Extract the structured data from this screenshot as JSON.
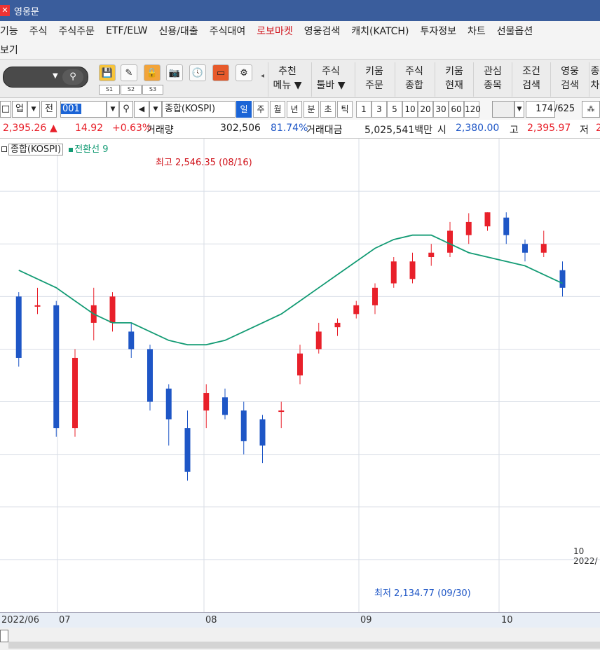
{
  "window": {
    "title": "영웅문",
    "icon": "kiwoom-icon"
  },
  "menu": {
    "row1": [
      "기능",
      "주식",
      "주식주문",
      "ETF/ELW",
      "신용/대출",
      "주식대여",
      "로보마켓",
      "영웅검색",
      "캐치(KATCH)",
      "투자정보",
      "차트",
      "선물옵션"
    ],
    "row2": [
      "보기"
    ]
  },
  "toolbar": {
    "s_tabs": [
      "S1",
      "S2",
      "S3"
    ],
    "buttons": [
      {
        "line1": "추천",
        "line2": "메뉴",
        "arrow": "▼"
      },
      {
        "line1": "주식",
        "line2": "툴바",
        "arrow": "▼"
      },
      {
        "line1": "키움",
        "line2": "주문",
        "arrow": ""
      },
      {
        "line1": "주식",
        "line2": "종합",
        "arrow": ""
      },
      {
        "line1": "키움",
        "line2": "현재",
        "arrow": ""
      },
      {
        "line1": "관심",
        "line2": "종목",
        "arrow": ""
      },
      {
        "line1": "조건",
        "line2": "검색",
        "arrow": ""
      },
      {
        "line1": "영웅",
        "line2": "검색",
        "arrow": ""
      },
      {
        "line1": "종",
        "line2": "차",
        "arrow": ""
      }
    ]
  },
  "stockbar": {
    "mode": "업",
    "prev": "전",
    "code": "001",
    "name": "종합(KOSPI)",
    "periods": [
      "일",
      "주",
      "월",
      "년",
      "분",
      "초",
      "틱"
    ],
    "active_period": "일",
    "intervals": [
      "1",
      "3",
      "5",
      "10",
      "20",
      "30",
      "60",
      "120"
    ],
    "count": "174",
    "total": "/625"
  },
  "quote": {
    "price": "2,395.26",
    "arrow": "▲",
    "change": "14.92",
    "pct": "+0.63%",
    "vol_label": "거래량",
    "volume": "302,506",
    "vol_ratio": "81.74%",
    "amount_label": "거래대금",
    "amount": "5,025,541백만",
    "open_label": "시",
    "open": "2,380.00",
    "high_label": "고",
    "high": "2,395.97",
    "low_label": "저",
    "low_partial": "2"
  },
  "legend": {
    "series1": "종합(KOSPI)",
    "series2": "전환선 9"
  },
  "colors": {
    "up": "#e8202a",
    "down": "#1e56c6",
    "line": "#139b74",
    "grid": "#d8dde6"
  },
  "annotations": {
    "high": "최고 2,546.35 (08/16)",
    "low": "최저 2,134.77 (09/30)",
    "label_10": "10",
    "label_2022": "2022/"
  },
  "dates": [
    "2022/06",
    "07",
    "08",
    "09",
    "10"
  ],
  "chart_data": {
    "type": "candlestick",
    "ylim": [
      2090,
      2630
    ],
    "candles": [
      {
        "o": 2450,
        "c": 2380,
        "h": 2455,
        "l": 2370
      },
      {
        "o": 2440,
        "c": 2440,
        "h": 2460,
        "l": 2430
      },
      {
        "o": 2440,
        "c": 2300,
        "h": 2445,
        "l": 2290
      },
      {
        "o": 2300,
        "c": 2380,
        "h": 2390,
        "l": 2290
      },
      {
        "o": 2420,
        "c": 2440,
        "h": 2460,
        "l": 2400
      },
      {
        "o": 2420,
        "c": 2450,
        "h": 2455,
        "l": 2410
      },
      {
        "o": 2410,
        "c": 2390,
        "h": 2420,
        "l": 2380
      },
      {
        "o": 2390,
        "c": 2330,
        "h": 2395,
        "l": 2320
      },
      {
        "o": 2345,
        "c": 2310,
        "h": 2350,
        "l": 2280
      },
      {
        "o": 2300,
        "c": 2250,
        "h": 2320,
        "l": 2240
      },
      {
        "o": 2320,
        "c": 2340,
        "h": 2350,
        "l": 2300
      },
      {
        "o": 2335,
        "c": 2315,
        "h": 2345,
        "l": 2310
      },
      {
        "o": 2320,
        "c": 2285,
        "h": 2330,
        "l": 2270
      },
      {
        "o": 2310,
        "c": 2280,
        "h": 2315,
        "l": 2260
      },
      {
        "o": 2320,
        "c": 2320,
        "h": 2330,
        "l": 2300
      },
      {
        "o": 2360,
        "c": 2385,
        "h": 2395,
        "l": 2350
      },
      {
        "o": 2390,
        "c": 2410,
        "h": 2420,
        "l": 2385
      },
      {
        "o": 2415,
        "c": 2420,
        "h": 2425,
        "l": 2405
      },
      {
        "o": 2430,
        "c": 2440,
        "h": 2445,
        "l": 2425
      },
      {
        "o": 2440,
        "c": 2460,
        "h": 2465,
        "l": 2430
      },
      {
        "o": 2465,
        "c": 2490,
        "h": 2495,
        "l": 2460
      },
      {
        "o": 2470,
        "c": 2490,
        "h": 2500,
        "l": 2465
      },
      {
        "o": 2495,
        "c": 2500,
        "h": 2510,
        "l": 2485
      },
      {
        "o": 2500,
        "c": 2525,
        "h": 2535,
        "l": 2495
      },
      {
        "o": 2520,
        "c": 2535,
        "h": 2545,
        "l": 2510
      },
      {
        "o": 2530,
        "c": 2546,
        "h": 2546,
        "l": 2525
      },
      {
        "o": 2540,
        "c": 2520,
        "h": 2546,
        "l": 2510
      },
      {
        "o": 2510,
        "c": 2500,
        "h": 2515,
        "l": 2490
      },
      {
        "o": 2500,
        "c": 2510,
        "h": 2525,
        "l": 2495
      },
      {
        "o": 2480,
        "c": 2460,
        "h": 2490,
        "l": 2450
      }
    ],
    "line": [
      2480,
      2470,
      2460,
      2445,
      2430,
      2420,
      2420,
      2410,
      2400,
      2395,
      2395,
      2400,
      2410,
      2420,
      2430,
      2445,
      2460,
      2475,
      2490,
      2505,
      2515,
      2520,
      2520,
      2510,
      2500,
      2495,
      2490,
      2485,
      2475,
      2465
    ]
  }
}
